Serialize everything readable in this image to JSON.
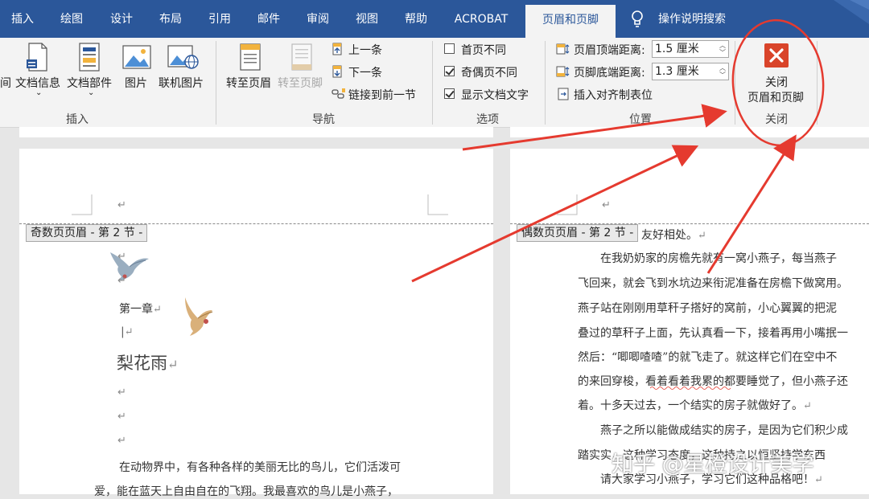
{
  "tabs": [
    "插入",
    "绘图",
    "设计",
    "布局",
    "引用",
    "邮件",
    "审阅",
    "视图",
    "帮助",
    "ACROBAT",
    "页眉和页脚",
    "操作说明搜索"
  ],
  "active_tab": "页眉和页脚",
  "ribbon": {
    "insert_group": {
      "cut_label": "间",
      "doc_info": "文档信息",
      "doc_parts": "文档部件",
      "picture": "图片",
      "online_picture": "联机图片",
      "group_label": "插入"
    },
    "nav_group": {
      "goto_header": "转至页眉",
      "goto_footer": "转至页脚",
      "prev": "上一条",
      "next": "下一条",
      "link_prev": "链接到前一节",
      "group_label": "导航"
    },
    "options_group": {
      "first_page_diff": {
        "label": "首页不同",
        "checked": false
      },
      "odd_even_diff": {
        "label": "奇偶页不同",
        "checked": true
      },
      "show_doc_text": {
        "label": "显示文档文字",
        "checked": true
      },
      "group_label": "选项"
    },
    "position_group": {
      "header_top_label": "页眉顶端距离:",
      "header_top_value": "1.5 厘米",
      "footer_bottom_label": "页脚底端距离:",
      "footer_bottom_value": "1.3 厘米",
      "insert_align_tab": "插入对齐制表位",
      "group_label": "位置"
    },
    "close_group": {
      "close_line1": "关闭",
      "close_line2": "页眉和页脚",
      "group_label": "关闭"
    }
  },
  "left_page": {
    "header_tag": "奇数页页眉 - 第 2 节 -",
    "chapter": "第一章",
    "title": "梨花雨",
    "body_line1": "在动物界中，有各种各样的美丽无比的鸟儿，它们活泼可",
    "body_line2": "爱，能在蓝天上自由自在的飞翔。我最喜欢的鸟儿是小燕子，"
  },
  "right_page": {
    "header_tag": "偶数页页眉 - 第 2 节 -",
    "lines": [
      "友好相处。",
      "　　在我奶奶家的房檐先就有一窝小燕子，每当燕子",
      "飞回来，就会飞到水坑边来衔泥准备在房檐下做窝用。",
      "燕子站在刚刚用草秆子搭好的窝前，小心翼翼的把泥",
      "叠过的草秆子上面，先认真看一下，接着再用小嘴抿一",
      "然后：“唧唧喳喳”的就飞走了。就这样它们在空中不",
      "的来回穿梭，看着看着我累的都要睡觉了，但小燕子还",
      "着。十多天过去，一个结实的房子就做好了。",
      "　　燕子之所以能做成结实的房子，是因为它们积少成",
      "踏实实，这种学习态度，这种持之以恒坚持学东西",
      "　　请大家学习小燕子，学习它们这种品格吧！"
    ]
  },
  "paragraph_mark": "↵",
  "watermark": "知乎 @星橙设计美学",
  "colors": {
    "tab_bar": "#2b579a",
    "ribbon_bg": "#f3f3f3",
    "close_button": "#d9442a",
    "annotation": "#e53a2f"
  }
}
